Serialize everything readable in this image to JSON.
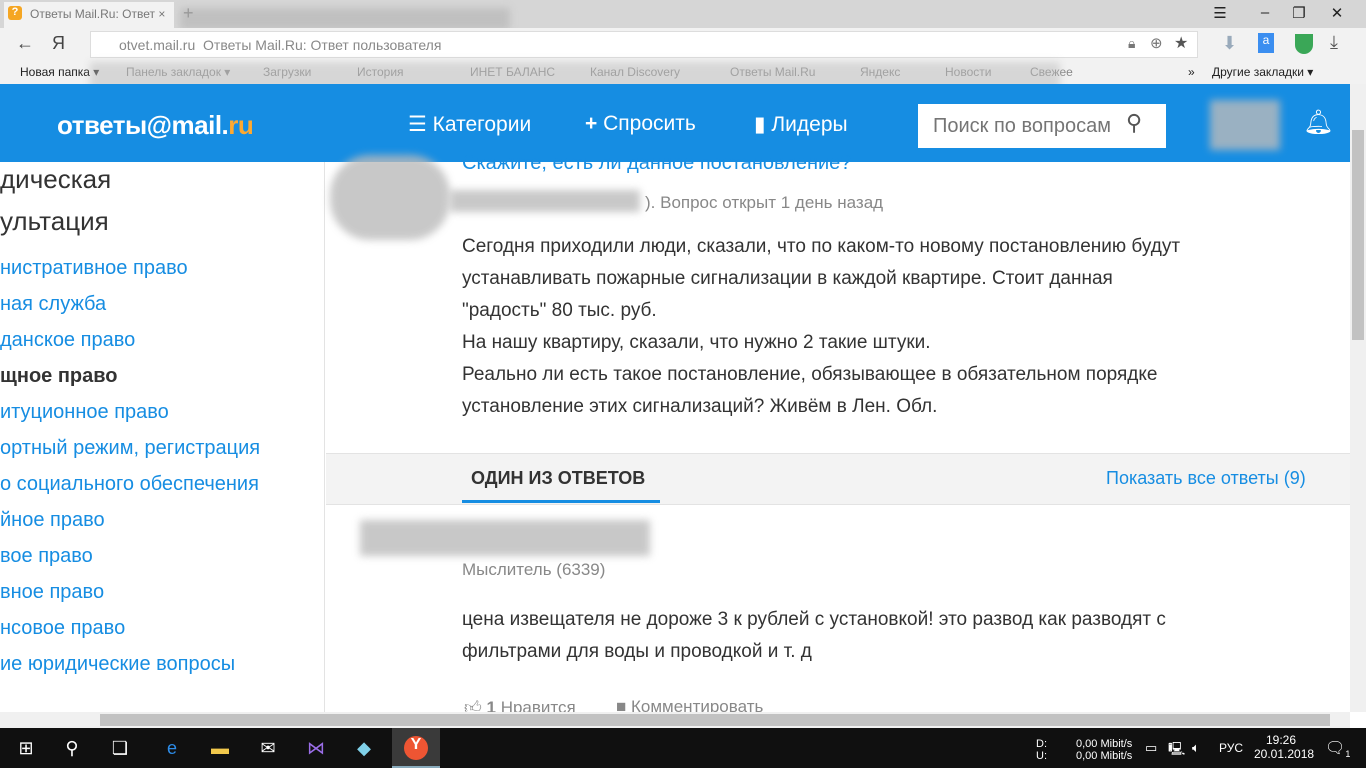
{
  "browser": {
    "tab_title": "Ответы Mail.Ru: Ответ",
    "new_tab": "+",
    "menu": "☰",
    "minimize": "–",
    "restore": "❐",
    "close": "✕",
    "address_host": "otvet.mail.ru",
    "address_title": "Ответы Mail.Ru: Ответ пользователя",
    "back": "←",
    "yandex": "Я",
    "bookmarks": [
      "Новая папка ▾",
      "Панель закладок ▾",
      "Загрузки",
      "История",
      "ИНЕТ БАЛАНС",
      "Канал Discovery",
      "Ответы Mail.Ru",
      "Яндекс",
      "Новости",
      "Свежее"
    ],
    "more": "»",
    "other_bookmarks": "Другие закладки ▾"
  },
  "header": {
    "logo_main": "ответы@mail.",
    "logo_ru": "ru",
    "nav": [
      "Категории",
      "Спросить",
      "Лидеры"
    ],
    "search_placeholder": "Поиск по вопросам"
  },
  "sidebar": {
    "title_lines": [
      "дическая",
      "ультация"
    ],
    "items": [
      {
        "label": "нистративное право"
      },
      {
        "label": "ная служба"
      },
      {
        "label": "данское право"
      },
      {
        "label": "щное право",
        "active": true
      },
      {
        "label": "итуционное право"
      },
      {
        "label": "ортный режим, регистрация"
      },
      {
        "label": "о социального обеспечения"
      },
      {
        "label": "йное право"
      },
      {
        "label": "вое право"
      },
      {
        "label": "вное право"
      },
      {
        "label": "нсовое право"
      },
      {
        "label": "ие юридические вопросы"
      }
    ]
  },
  "question": {
    "title": "Скажите, есть ли данное постановление?",
    "meta": "). Вопрос открыт 1 день назад",
    "body": [
      "Сегодня приходили люди, сказали, что по каком-то новому постановлению будут",
      "устанавливать пожарные сигнализации в каждой квартире. Стоит данная",
      "\"радость\" 80 тыс. руб.",
      "На нашу квартиру, сказали, что нужно 2 такие штуки.",
      "Реально ли есть такое постановление, обязывающее в обязательном порядке",
      "установление этих сигнализаций? Живём в Лен. Обл."
    ]
  },
  "answers": {
    "tab": "ОДИН ИЗ ОТВЕТОВ",
    "show_all": "Показать все ответы (9)",
    "author_rank": "Мыслитель (6339)",
    "body": [
      "цена извещателя не дороже 3 к рублей с установкой! это развод как разводят с",
      "фильтрами для воды и проводкой и т. д"
    ],
    "likes": "1",
    "like_label": "Нравится",
    "comment_label": "Комментировать"
  },
  "taskbar": {
    "net_d_label": "D:",
    "net_u_label": "U:",
    "net_d": "0,00 Mibit/s",
    "net_u": "0,00 Mibit/s",
    "lang": "РУС",
    "time": "19:26",
    "date": "20.01.2018",
    "notifications": "1"
  },
  "colors": {
    "brand": "#168de2",
    "logo_accent": "#ffa930"
  }
}
